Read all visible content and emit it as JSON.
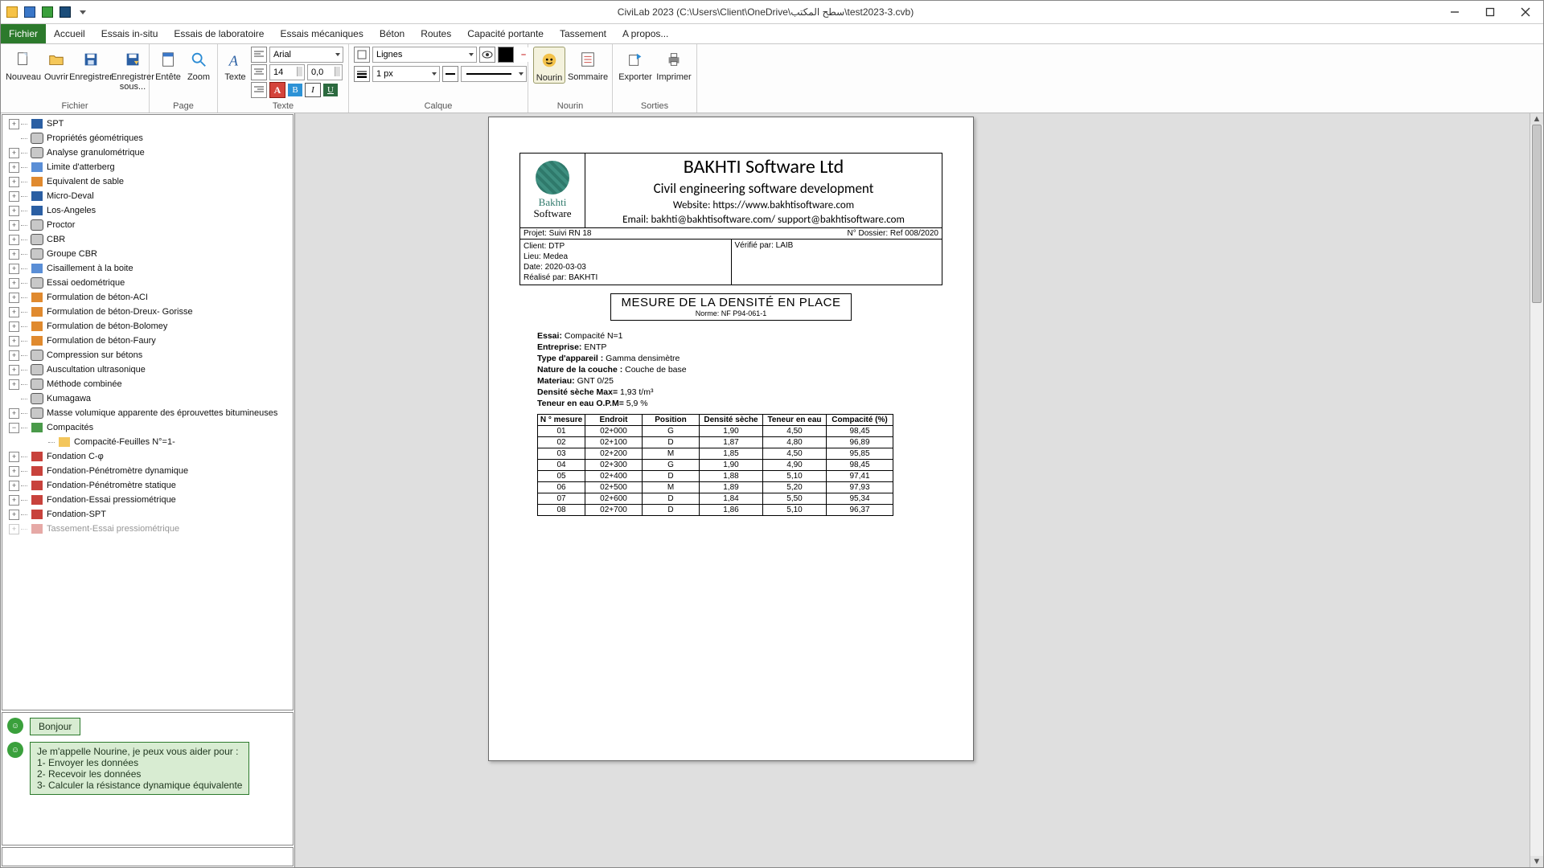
{
  "title": "CiviLab  2023 (C:\\Users\\Client\\OneDrive\\سطح المكتب\\test2023-3.cvb)",
  "tabs": [
    "Fichier",
    "Accueil",
    "Essais in-situ",
    "Essais de laboratoire",
    "Essais mécaniques",
    "Béton",
    "Routes",
    "Capacité portante",
    "Tassement",
    "A propos..."
  ],
  "activeTab": 0,
  "ribbon": {
    "fichier": {
      "label": "Fichier",
      "items": [
        "Nouveau",
        "Ouvrir",
        "Enregistrer",
        "Enregistrer sous..."
      ]
    },
    "page": {
      "label": "Page",
      "items": [
        "Entête",
        "Zoom"
      ]
    },
    "texte": {
      "label": "Texte",
      "texteBtn": "Texte",
      "font": "Arial",
      "size": "14",
      "indent": "0,0"
    },
    "calque": {
      "label": "Calque",
      "layer": "Lignes",
      "stroke": "1 px"
    },
    "nourin": {
      "label": "Nourin",
      "items": [
        "Nourin",
        "Sommaire"
      ]
    },
    "sorties": {
      "label": "Sorties",
      "items": [
        "Exporter",
        "Imprimer"
      ]
    }
  },
  "tree": [
    {
      "t": "SPT",
      "i": "db"
    },
    {
      "t": "Propriétés géométriques",
      "i": "cyl",
      "noexp": true
    },
    {
      "t": "Analyse granulométrique",
      "i": "cyl"
    },
    {
      "t": "Limite d'atterberg",
      "i": "blue"
    },
    {
      "t": "Equivalent de sable",
      "i": "orange"
    },
    {
      "t": "Micro-Deval",
      "i": "db"
    },
    {
      "t": "Los-Angeles",
      "i": "db"
    },
    {
      "t": "Proctor",
      "i": "cyl"
    },
    {
      "t": "CBR",
      "i": "cyl"
    },
    {
      "t": "Groupe CBR",
      "i": "cyl"
    },
    {
      "t": "Cisaillement à la boite",
      "i": "blue"
    },
    {
      "t": "Essai oedométrique",
      "i": "cyl"
    },
    {
      "t": "Formulation de béton-ACI",
      "i": "orange"
    },
    {
      "t": "Formulation de béton-Dreux- Gorisse",
      "i": "orange"
    },
    {
      "t": "Formulation de béton-Bolomey",
      "i": "orange"
    },
    {
      "t": "Formulation de béton-Faury",
      "i": "orange"
    },
    {
      "t": "Compression sur bétons",
      "i": "cyl"
    },
    {
      "t": "Auscultation ultrasonique",
      "i": "cyl"
    },
    {
      "t": "Méthode combinée",
      "i": "cyl"
    },
    {
      "t": "Kumagawa",
      "i": "cyl",
      "noexp": true
    },
    {
      "t": "Masse volumique apparente des éprouvettes bitumineuses",
      "i": "cyl"
    },
    {
      "t": "Compacités",
      "i": "grn",
      "open": true
    },
    {
      "t": "Compacité-Feuilles N°=1-",
      "i": "fold",
      "child": true,
      "noexp": true
    },
    {
      "t": "Fondation C-φ",
      "i": "red"
    },
    {
      "t": "Fondation-Pénétromètre dynamique",
      "i": "red"
    },
    {
      "t": "Fondation-Pénétromètre statique",
      "i": "red"
    },
    {
      "t": "Fondation-Essai pressiométrique",
      "i": "red"
    },
    {
      "t": "Fondation-SPT",
      "i": "red"
    },
    {
      "t": "Tassement-Essai pressiométrique",
      "i": "red",
      "cut": true
    }
  ],
  "chat": {
    "greeting": "Bonjour",
    "intro": "Je m'appelle Nourine, je peux vous aider pour :",
    "l1": "1- Envoyer les données",
    "l2": "2- Recevoir les données",
    "l3": "3- Calculer la résistance dynamique équivalente"
  },
  "report": {
    "company": "BAKHTI Software Ltd",
    "tagline": "Civil engineering software development",
    "website": "Website: https://www.bakhtisoftware.com",
    "email": "Email: bakhti@bakhtisoftware.com/ support@bakhtisoftware.com",
    "logoTop": "Bakhti",
    "logoBottom": "Software",
    "project": "Projet: Suivi RN 18",
    "dossier": "N° Dossier: Ref 008/2020",
    "client": "Client: DTP",
    "lieu": "Lieu: Medea",
    "date": "Date: 2020-03-03",
    "realise": "Réalisé par: BAKHTI",
    "verifie": "Vérifié par: LAIB",
    "title": "MESURE DE LA DENSITÉ EN PLACE",
    "norm": "Norme: NF P94-061-1",
    "meta": {
      "essai_l": "Essai: ",
      "essai_v": "Compacité N=1",
      "ent_l": "Entreprise: ",
      "ent_v": "ENTP",
      "app_l": "Type d'appareil : ",
      "app_v": "Gamma densimètre",
      "nat_l": "Nature de la couche : ",
      "nat_v": "Couche de base",
      "mat_l": "Materiau: ",
      "mat_v": "GNT 0/25",
      "dmax_l": "Densité sèche Max= ",
      "dmax_v": "1,93 t/m³",
      "teau_l": "Teneur en eau O.P.M= ",
      "teau_v": "5,9 %"
    },
    "headers": [
      "N ° mesure",
      "Endroit",
      "Position",
      "Densité sèche",
      "Teneur en eau",
      "Compacité (%)"
    ],
    "rows": [
      [
        "01",
        "02+000",
        "G",
        "1,90",
        "4,50",
        "98,45"
      ],
      [
        "02",
        "02+100",
        "D",
        "1,87",
        "4,80",
        "96,89"
      ],
      [
        "03",
        "02+200",
        "M",
        "1,85",
        "4,50",
        "95,85"
      ],
      [
        "04",
        "02+300",
        "G",
        "1,90",
        "4,90",
        "98,45"
      ],
      [
        "05",
        "02+400",
        "D",
        "1,88",
        "5,10",
        "97,41"
      ],
      [
        "06",
        "02+500",
        "M",
        "1,89",
        "5,20",
        "97,93"
      ],
      [
        "07",
        "02+600",
        "D",
        "1,84",
        "5,50",
        "95,34"
      ],
      [
        "08",
        "02+700",
        "D",
        "1,86",
        "5,10",
        "96,37"
      ]
    ]
  },
  "chart_data": {
    "type": "table",
    "title": "MESURE DE LA DENSITÉ EN PLACE",
    "columns": [
      "N ° mesure",
      "Endroit",
      "Position",
      "Densité sèche",
      "Teneur en eau",
      "Compacité (%)"
    ],
    "rows": [
      [
        "01",
        "02+000",
        "G",
        1.9,
        4.5,
        98.45
      ],
      [
        "02",
        "02+100",
        "D",
        1.87,
        4.8,
        96.89
      ],
      [
        "03",
        "02+200",
        "M",
        1.85,
        4.5,
        95.85
      ],
      [
        "04",
        "02+300",
        "G",
        1.9,
        4.9,
        98.45
      ],
      [
        "05",
        "02+400",
        "D",
        1.88,
        5.1,
        97.41
      ],
      [
        "06",
        "02+500",
        "M",
        1.89,
        5.2,
        97.93
      ],
      [
        "07",
        "02+600",
        "D",
        1.84,
        5.5,
        95.34
      ],
      [
        "08",
        "02+700",
        "D",
        1.86,
        5.1,
        96.37
      ]
    ]
  }
}
